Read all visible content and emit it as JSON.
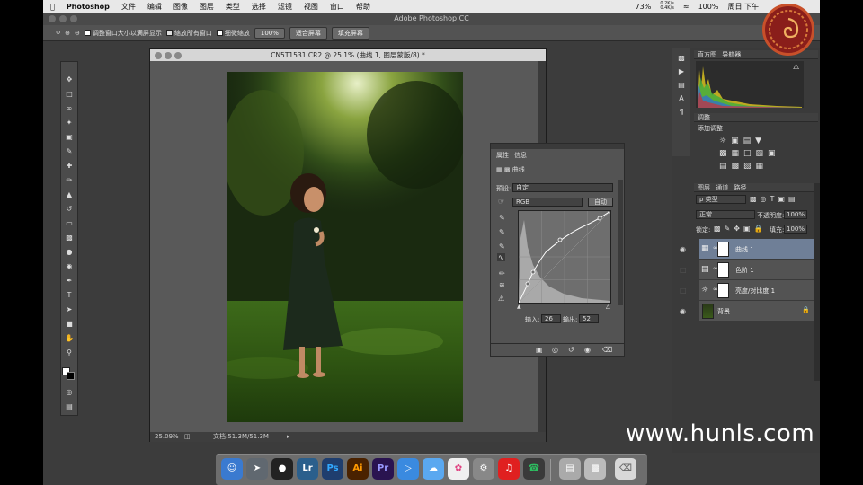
{
  "menubar": {
    "app": "Photoshop",
    "items": [
      "文件",
      "编辑",
      "图像",
      "图层",
      "类型",
      "选择",
      "滤镜",
      "视图",
      "窗口",
      "帮助"
    ],
    "battery": "73%",
    "net_up": "0.2K/s",
    "net_down": "0.4K/s",
    "zoom": "100%",
    "clock": "周日 下午"
  },
  "window": {
    "title": "Adobe Photoshop CC"
  },
  "optbar": {
    "opt1": "调整窗口大小以满屏显示",
    "opt2": "缩放所有窗口",
    "opt3": "细微缩放",
    "btn_zoom": "100%",
    "btn_fit": "适合屏幕",
    "btn_fill": "填充屏幕"
  },
  "document": {
    "title": "CN5T1531.CR2 @ 25.1% (曲线 1, 图层蒙版/8) *",
    "zoom": "25.09%",
    "docsize": "文档:51.3M/51.3M"
  },
  "curves_panel": {
    "tab_props": "属性",
    "tab_info": "信息",
    "name": "曲线",
    "preset_label": "预设:",
    "preset_value": "自定",
    "channel": "RGB",
    "auto_btn": "自动",
    "input_label": "输入:",
    "input_value": "26",
    "output_label": "输出:",
    "output_value": "52"
  },
  "right_dock": {
    "histogram_tab": "直方图",
    "navigator_tab": "导航器",
    "adjust_tab": "调整",
    "adjust_add": "添加调整",
    "layers_tabs": [
      "图层",
      "通道",
      "路径"
    ],
    "kind": "ρ 类型",
    "blend": "正常",
    "opacity_label": "不透明度:",
    "opacity_value": "100%",
    "lock_label": "锁定:",
    "fill_label": "填充:",
    "fill_value": "100%",
    "layers": [
      {
        "name": "曲线 1",
        "selected": true
      },
      {
        "name": "色阶 1",
        "selected": false
      },
      {
        "name": "亮度/对比度 1",
        "selected": false
      },
      {
        "name": "背景",
        "selected": false
      }
    ]
  },
  "dock_apps": [
    "Lr",
    "Ps",
    "Ai",
    "Pr"
  ],
  "watermark": "www.hunls.com",
  "colors": {
    "accent": "#6f7f97",
    "ps_blue": "#31a8ff",
    "lr_blue": "#2b5f8c",
    "ai_orange": "#ff9a00",
    "pr_purple": "#9999ff"
  }
}
